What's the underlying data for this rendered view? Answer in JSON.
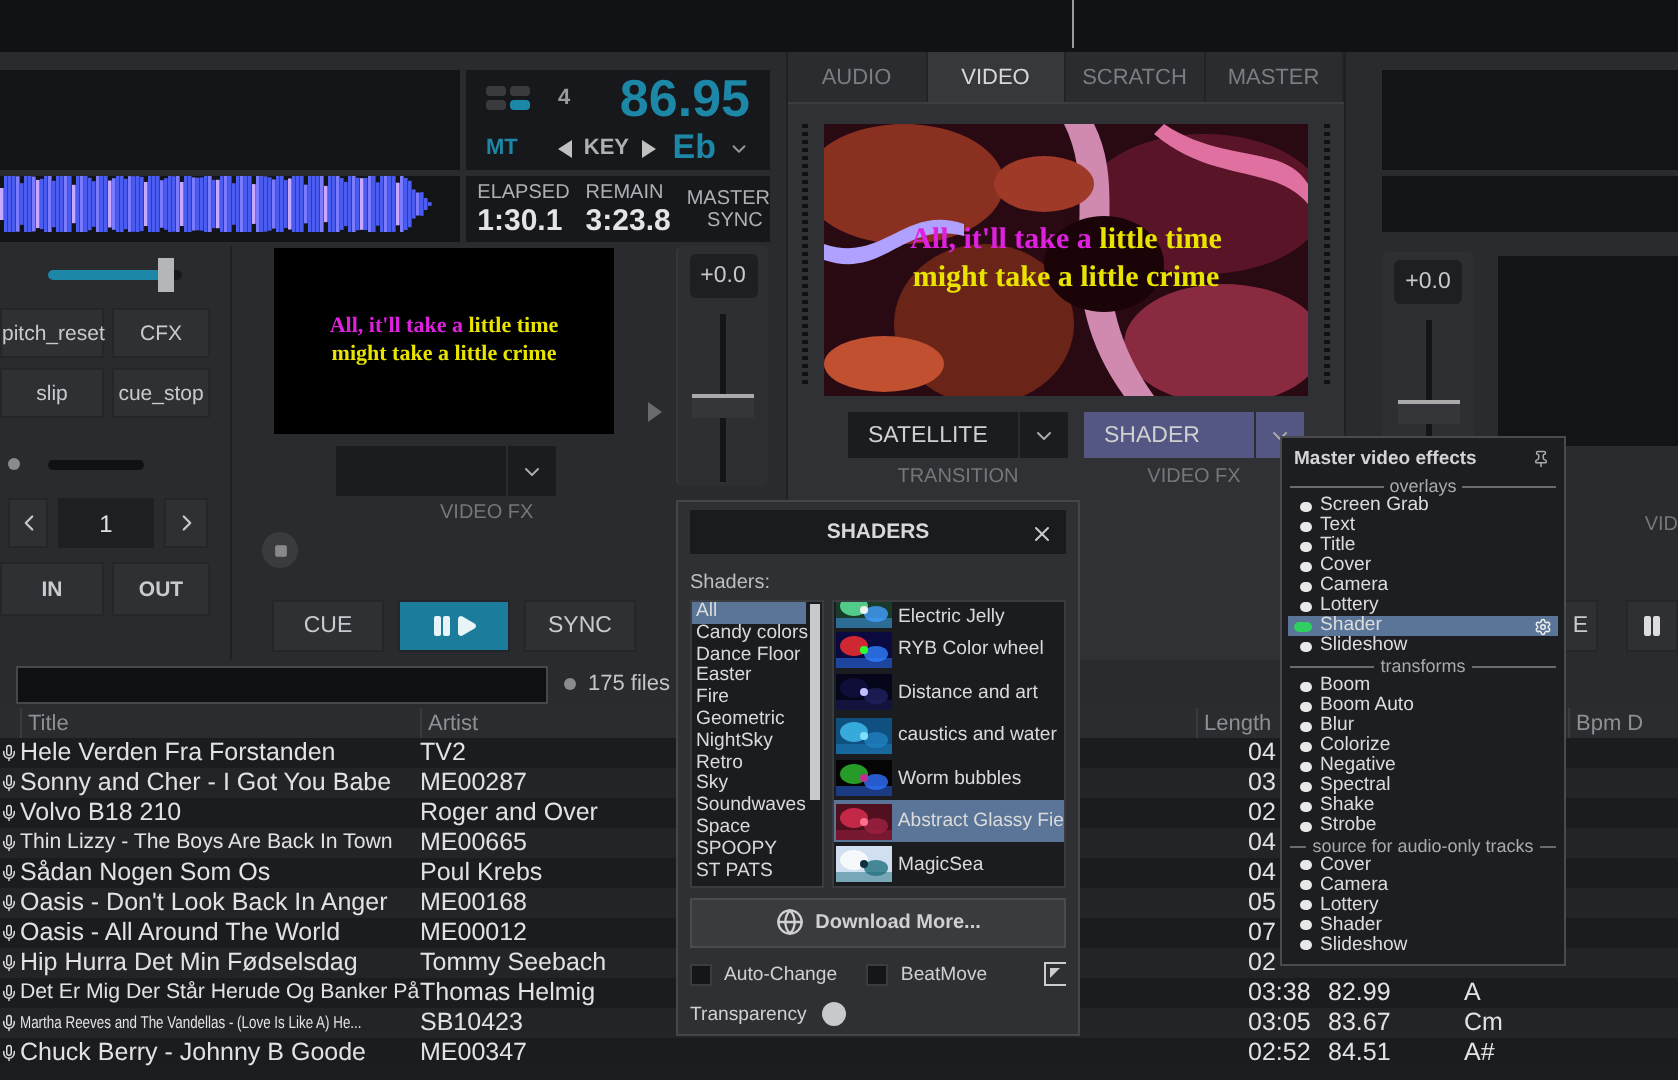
{
  "deck_left": {
    "beat_count": "4",
    "bpm": "86.95",
    "mt": "MT",
    "key_label": "KEY",
    "key": "Eb",
    "elapsed_label": "ELAPSED",
    "elapsed": "1:30.1",
    "remain_label": "REMAIN",
    "remain": "3:23.8",
    "master_sync": "MASTER SYNC",
    "top_slider": {
      "level": 0.88
    },
    "pads": [
      "pitch_reset",
      "CFX",
      "slip",
      "cue_stop"
    ],
    "loop_value": "1",
    "in_out": [
      "IN",
      "OUT"
    ],
    "lyrics": [
      {
        "sung": "All, it'll take a",
        "unsung": "little time"
      },
      {
        "unsung": "might take a little crime"
      }
    ],
    "video_fx_label": "VIDEO FX",
    "transport": [
      {
        "kind": "text",
        "label": "CUE",
        "active": false
      },
      {
        "kind": "playpause",
        "active": true
      },
      {
        "kind": "text",
        "label": "SYNC",
        "active": false
      }
    ],
    "pitch": "+0.0",
    "pitch_fader": {
      "level": 0.45
    }
  },
  "mixer": {
    "tabs": [
      {
        "label": "AUDIO",
        "selected": false
      },
      {
        "label": "VIDEO",
        "selected": true
      },
      {
        "label": "SCRATCH",
        "selected": false
      },
      {
        "label": "MASTER",
        "selected": false
      }
    ],
    "lyrics": [
      {
        "sung": "All, it'll take a",
        "unsung": "little time"
      },
      {
        "unsung": "might take a little crime"
      }
    ],
    "transition": "SATELLITE",
    "transition_label": "TRANSITION",
    "video_fx": "SHADER",
    "video_fx_label": "VIDEO FX"
  },
  "deck_right": {
    "pitch": "+0.0",
    "pitch_fader": {
      "level": 0.45
    },
    "video_fx_label": "VID",
    "cue_button": "E"
  },
  "browser": {
    "file_count": "175 files",
    "columns": [
      "Title",
      "Artist",
      "Length",
      "Bpm D"
    ],
    "rows": [
      {
        "title": "Hele Verden Fra Forstanden",
        "artist": "TV2",
        "length": "04"
      },
      {
        "title": "Sonny and Cher - I Got You Babe",
        "artist": "ME00287",
        "length": "03"
      },
      {
        "title": "Volvo B18 210",
        "artist": "Roger and Over",
        "length": "02"
      },
      {
        "title": "Thin Lizzy - The Boys Are Back In Town",
        "artist": "ME00665",
        "length": "04"
      },
      {
        "title": "Sådan Nogen Som Os",
        "artist": "Poul Krebs",
        "length": "04"
      },
      {
        "title": "Oasis - Don't Look Back In Anger",
        "artist": "ME00168",
        "length": "05"
      },
      {
        "title": "Oasis - All Around The World",
        "artist": "ME00012",
        "length": "07"
      },
      {
        "title": "Hip Hurra Det Min Fødselsdag",
        "artist": "Tommy Seebach",
        "length": "02"
      },
      {
        "title": "Det Er Mig Der Står Herude Og Banker På",
        "artist": "Thomas Helmig",
        "length": "03:38",
        "column_4": "82.99",
        "column_5": "A"
      },
      {
        "title": "Martha Reeves and The Vandellas - (Love Is Like A) He...",
        "artist": "SB10423",
        "length": "03:05",
        "column_4": "83.67",
        "column_5": "Cm"
      },
      {
        "title": "Chuck Berry - Johnny B Goode",
        "artist": "ME00347",
        "length": "02:52",
        "column_4": "84.51",
        "column_5": "A#"
      }
    ]
  },
  "shaders_panel": {
    "title": "SHADERS",
    "label": "Shaders:",
    "categories": [
      {
        "label": "All",
        "selected": true
      },
      {
        "label": "Candy colors",
        "selected": false
      },
      {
        "label": "Dance Floor",
        "selected": false
      },
      {
        "label": "Easter",
        "selected": false
      },
      {
        "label": "Fire",
        "selected": false
      },
      {
        "label": "Geometric",
        "selected": false
      },
      {
        "label": "NightSky",
        "selected": false
      },
      {
        "label": "Retro",
        "selected": false
      },
      {
        "label": "Sky",
        "selected": false
      },
      {
        "label": "Soundwaves",
        "selected": false
      },
      {
        "label": "Space",
        "selected": false
      },
      {
        "label": "SPOOPY",
        "selected": false
      },
      {
        "label": "ST PATS",
        "selected": false
      }
    ],
    "shaders": [
      {
        "name": "Electric Jelly",
        "selected": false
      },
      {
        "name": "RYB Color wheel",
        "selected": false
      },
      {
        "name": "Distance and art",
        "selected": false
      },
      {
        "name": "caustics and water",
        "selected": false
      },
      {
        "name": "Worm bubbles",
        "selected": false
      },
      {
        "name": "Abstract Glassy Fie",
        "selected": true
      },
      {
        "name": "MagicSea",
        "selected": false
      }
    ],
    "download": "Download More...",
    "options": [
      {
        "label": "Auto-Change",
        "checked": false
      },
      {
        "label": "BeatMove",
        "checked": false
      }
    ],
    "transparency": "Transparency"
  },
  "effects_menu": {
    "title": "Master video effects",
    "entries": [
      {
        "kind": "section",
        "label": "overlays"
      },
      {
        "kind": "effect",
        "label": "Screen Grab",
        "on": false,
        "selected": false
      },
      {
        "kind": "effect",
        "label": "Text",
        "on": false,
        "selected": false
      },
      {
        "kind": "effect",
        "label": "Title",
        "on": false,
        "selected": false
      },
      {
        "kind": "effect",
        "label": "Cover",
        "on": false,
        "selected": false
      },
      {
        "kind": "effect",
        "label": "Camera",
        "on": false,
        "selected": false
      },
      {
        "kind": "effect",
        "label": "Lottery",
        "on": false,
        "selected": false
      },
      {
        "kind": "effect",
        "label": "Shader",
        "on": true,
        "selected": true
      },
      {
        "kind": "effect",
        "label": "Slideshow",
        "on": false,
        "selected": false
      },
      {
        "kind": "section",
        "label": "transforms"
      },
      {
        "kind": "effect",
        "label": "Boom",
        "on": false,
        "selected": false
      },
      {
        "kind": "effect",
        "label": "Boom Auto",
        "on": false,
        "selected": false
      },
      {
        "kind": "effect",
        "label": "Blur",
        "on": false,
        "selected": false
      },
      {
        "kind": "effect",
        "label": "Colorize",
        "on": false,
        "selected": false
      },
      {
        "kind": "effect",
        "label": "Negative",
        "on": false,
        "selected": false
      },
      {
        "kind": "effect",
        "label": "Spectral",
        "on": false,
        "selected": false
      },
      {
        "kind": "effect",
        "label": "Shake",
        "on": false,
        "selected": false
      },
      {
        "kind": "effect",
        "label": "Strobe",
        "on": false,
        "selected": false
      },
      {
        "kind": "section",
        "label": "source for audio-only tracks"
      },
      {
        "kind": "effect",
        "label": "Cover",
        "on": false,
        "selected": false
      },
      {
        "kind": "effect",
        "label": "Camera",
        "on": false,
        "selected": false
      },
      {
        "kind": "effect",
        "label": "Lottery",
        "on": false,
        "selected": false
      },
      {
        "kind": "effect",
        "label": "Shader",
        "on": false,
        "selected": false
      },
      {
        "kind": "effect",
        "label": "Slideshow",
        "on": false,
        "selected": false
      }
    ]
  }
}
